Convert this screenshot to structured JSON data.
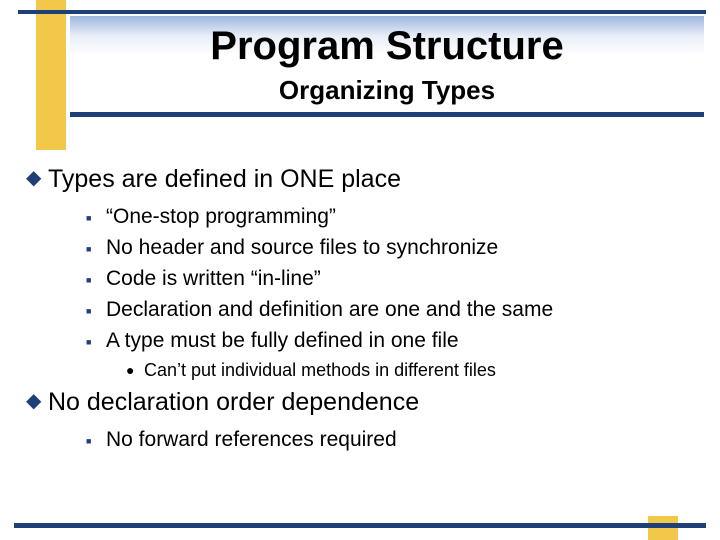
{
  "header": {
    "title": "Program Structure",
    "subtitle": "Organizing Types"
  },
  "content": {
    "point1": {
      "text": "Types are defined in ONE place",
      "sub": [
        "“One-stop programming”",
        "No header and source files to synchronize",
        "Code is written “in-line”",
        "Declaration and definition are one and the same",
        "A type must be fully defined in one file"
      ],
      "subsub": [
        "Can’t put individual methods in different files"
      ]
    },
    "point2": {
      "text": "No declaration order dependence",
      "sub": [
        "No forward references required"
      ]
    }
  },
  "colors": {
    "accent_navy": "#1e3f78",
    "accent_gold": "#f2c84b"
  }
}
